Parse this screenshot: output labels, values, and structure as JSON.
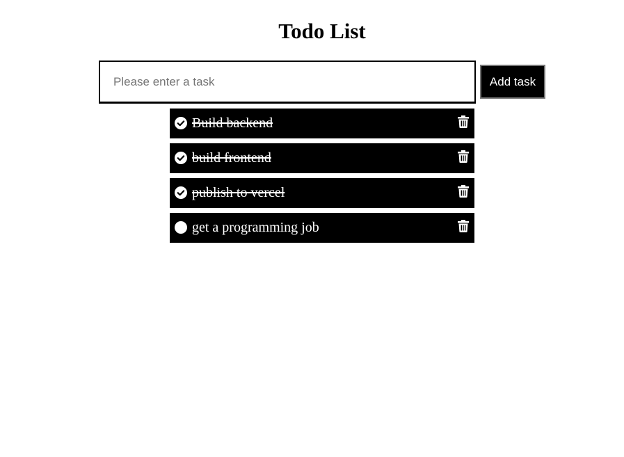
{
  "page": {
    "title": "Todo List"
  },
  "input": {
    "value": "",
    "placeholder": "Please enter a task"
  },
  "add_button": {
    "label": "Add task"
  },
  "todos": [
    {
      "text": "Build backend",
      "completed": true,
      "status_icon": "check-circle-icon",
      "action_icon": "trash-icon"
    },
    {
      "text": "build frontend",
      "completed": true,
      "status_icon": "check-circle-icon",
      "action_icon": "trash-icon"
    },
    {
      "text": "publish to vercel",
      "completed": true,
      "status_icon": "check-circle-icon",
      "action_icon": "trash-icon"
    },
    {
      "text": "get a programming job",
      "completed": false,
      "status_icon": "empty-circle-icon",
      "action_icon": "trash-icon"
    }
  ],
  "colors": {
    "item_background": "#000000",
    "item_text": "#ffffff",
    "button_background": "#000000",
    "button_text": "#ffffff"
  }
}
